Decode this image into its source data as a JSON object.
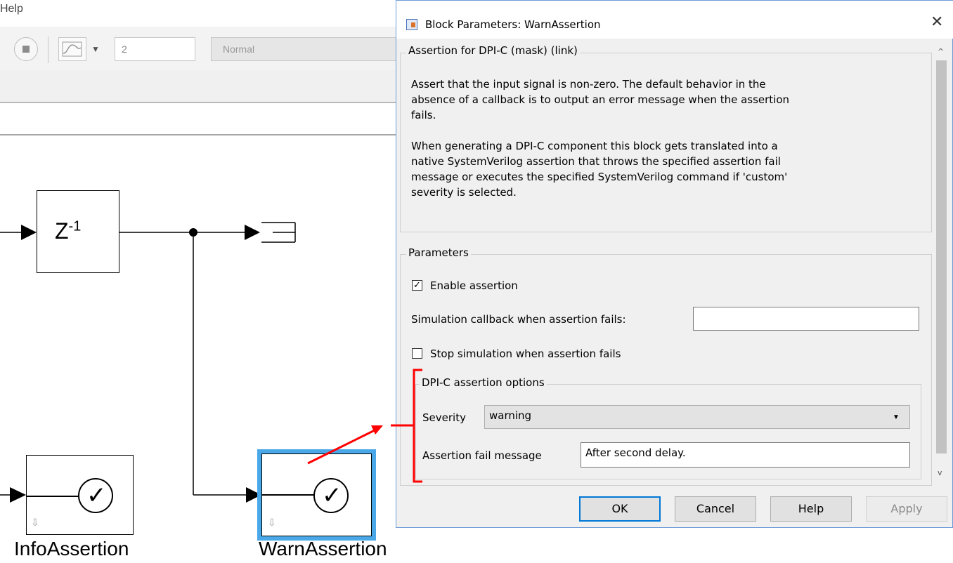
{
  "menu": {
    "help_label": "Help"
  },
  "toolbar": {
    "stop_time_value": "2",
    "sim_mode_value": "Normal"
  },
  "canvas": {
    "delay_block_label": "Z",
    "delay_block_exponent": "-1",
    "check_glyph": "✓",
    "down_glyph": "⇩",
    "info_block_name": "InfoAssertion",
    "warn_block_name": "WarnAssertion"
  },
  "dialog": {
    "title": "Block Parameters: WarnAssertion",
    "close_glyph": "✕",
    "description_legend": "Assertion for DPI-C (mask) (link)",
    "description_lines": [
      "Assert that the input signal is non-zero. The default behavior in the",
      "absence of a callback is to output an error message when the assertion",
      "fails.",
      "",
      "When generating a DPI-C component this block gets translated into a",
      "native SystemVerilog assertion that throws the specified assertion fail",
      "message or executes the specified SystemVerilog command if 'custom'",
      "severity is selected."
    ],
    "parameters_legend": "Parameters",
    "enable_assertion": {
      "label": "Enable assertion",
      "checked": true,
      "mark": "✓"
    },
    "callback": {
      "label": "Simulation callback when assertion fails:",
      "value": ""
    },
    "stop_simulation": {
      "label": "Stop simulation when assertion fails",
      "checked": false,
      "mark": ""
    },
    "dpi_legend": "DPI-C assertion options",
    "severity": {
      "label": "Severity",
      "value": "warning"
    },
    "fail_message": {
      "label": "Assertion fail message",
      "value": "After second delay."
    },
    "buttons": {
      "ok": "OK",
      "cancel": "Cancel",
      "help": "Help",
      "apply": "Apply"
    }
  },
  "annotation": {
    "color": "#ff0000"
  }
}
